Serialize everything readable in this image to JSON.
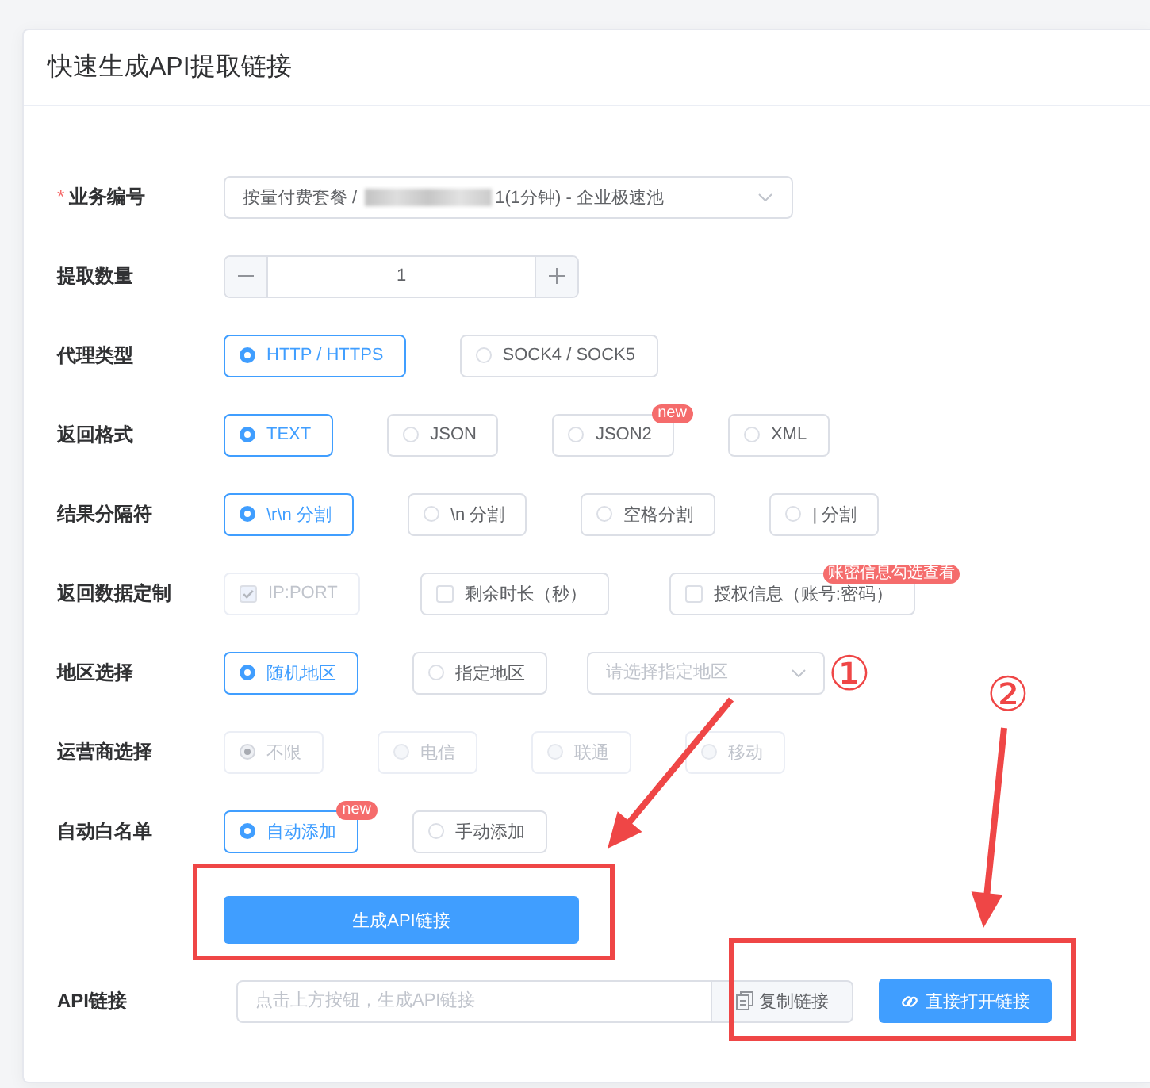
{
  "card": {
    "title": "快速生成API提取链接"
  },
  "fields": [
    {
      "kind": "select",
      "label": "业务编号",
      "required_mark": "*",
      "value_start": "按量付费套餐 /",
      "redacted": true,
      "value_end": "1(1分钟) - 企业极速池"
    },
    {
      "kind": "stepper",
      "label": "提取数量",
      "value": "1"
    },
    {
      "kind": "radio",
      "label": "代理类型",
      "options": [
        {
          "label": "HTTP / HTTPS",
          "selected": true,
          "disabled": false
        },
        {
          "label": "SOCK4 / SOCK5",
          "selected": false,
          "disabled": false
        }
      ]
    },
    {
      "kind": "radio",
      "label": "返回格式",
      "options": [
        {
          "label": "TEXT",
          "selected": true,
          "disabled": false
        },
        {
          "label": "JSON",
          "selected": false,
          "disabled": false
        },
        {
          "label": "JSON2",
          "selected": false,
          "disabled": false,
          "badge": "new"
        },
        {
          "label": "XML",
          "selected": false,
          "disabled": false
        }
      ]
    },
    {
      "kind": "radio",
      "label": "结果分隔符",
      "options": [
        {
          "label": "\\r\\n 分割",
          "selected": true,
          "disabled": false
        },
        {
          "label": "\\n 分割",
          "selected": false,
          "disabled": false
        },
        {
          "label": "空格分割",
          "selected": false,
          "disabled": false
        },
        {
          "label": "| 分割",
          "selected": false,
          "disabled": false
        }
      ]
    },
    {
      "kind": "checkbox",
      "label": "返回数据定制",
      "options": [
        {
          "label": "IP:PORT",
          "checked": true,
          "disabled": true
        },
        {
          "label": "剩余时长（秒）",
          "checked": false,
          "disabled": false
        },
        {
          "label": "授权信息（账号:密码）",
          "checked": false,
          "disabled": false,
          "badge": "账密信息勾选查看"
        }
      ]
    },
    {
      "kind": "radio",
      "label": "地区选择",
      "options": [
        {
          "label": "随机地区",
          "selected": true,
          "disabled": false
        },
        {
          "label": "指定地区",
          "selected": false,
          "disabled": false
        }
      ],
      "select": {
        "placeholder": "请选择指定地区"
      }
    },
    {
      "kind": "radio",
      "label": "运营商选择",
      "options": [
        {
          "label": "不限",
          "selected": true,
          "disabled": true
        },
        {
          "label": "电信",
          "selected": false,
          "disabled": true
        },
        {
          "label": "联通",
          "selected": false,
          "disabled": true
        },
        {
          "label": "移动",
          "selected": false,
          "disabled": true
        }
      ]
    },
    {
      "kind": "radio",
      "label": "自动白名单",
      "options": [
        {
          "label": "自动添加",
          "selected": true,
          "disabled": false,
          "badge": "new"
        },
        {
          "label": "手动添加",
          "selected": false,
          "disabled": false
        }
      ]
    }
  ],
  "generate_button": "生成API链接",
  "api_link": {
    "label": "API链接",
    "placeholder": "点击上方按钮，生成API链接",
    "copy_button": "复制链接",
    "open_button": "直接打开链接"
  },
  "annotations": [
    {
      "marker": "①"
    },
    {
      "marker": "②"
    }
  ]
}
